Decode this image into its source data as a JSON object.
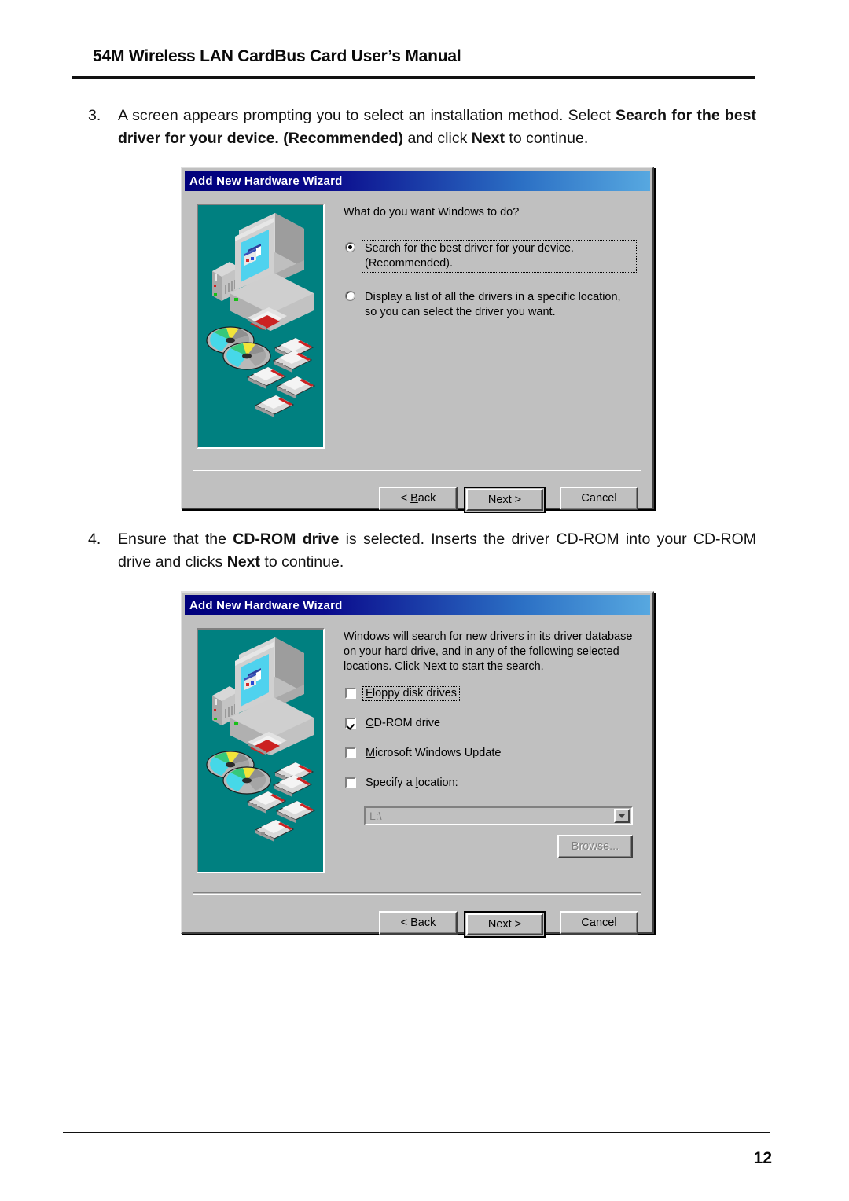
{
  "header": {
    "title": "54M Wireless LAN CardBus Card User’s Manual",
    "page_number": "12"
  },
  "steps": [
    {
      "number": "3.",
      "segments": [
        {
          "text": "A screen appears prompting you to select an installation method. Select ",
          "bold": false
        },
        {
          "text": "Search for the best driver for your device. (Recommended)",
          "bold": true
        },
        {
          "text": " and click ",
          "bold": false
        },
        {
          "text": "Next",
          "bold": true
        },
        {
          "text": " to continue.",
          "bold": false
        }
      ]
    },
    {
      "number": "4.",
      "segments": [
        {
          "text": "Ensure that the ",
          "bold": false
        },
        {
          "text": "CD-ROM drive",
          "bold": true
        },
        {
          "text": " is selected. Inserts the driver CD-ROM into your CD-ROM drive and clicks ",
          "bold": false
        },
        {
          "text": "Next",
          "bold": true
        },
        {
          "text": " to continue.",
          "bold": false
        }
      ]
    }
  ],
  "dialog1": {
    "title": "Add New Hardware Wizard",
    "prompt": "What do you want Windows to do?",
    "options": [
      {
        "label": "Search for the best driver for your device. (Recommended).",
        "selected": true,
        "focused": true
      },
      {
        "label": "Display a list of all the drivers in a specific location, so you can select the driver you want.",
        "selected": false,
        "focused": false
      }
    ],
    "buttons": {
      "back": "< Back",
      "next": "Next >",
      "cancel": "Cancel"
    }
  },
  "dialog2": {
    "title": "Add New Hardware Wizard",
    "prompt": "Windows will search for new drivers in its driver database on your hard drive, and in any of the following selected locations. Click Next to start the search.",
    "checkboxes": [
      {
        "accel": "F",
        "rest": "loppy disk drives",
        "checked": false,
        "focused": true
      },
      {
        "accel": "C",
        "rest": "D-ROM drive",
        "checked": true,
        "focused": false
      },
      {
        "accel": "M",
        "rest": "icrosoft Windows Update",
        "checked": false,
        "focused": false
      },
      {
        "accel": "",
        "rest": "Specify a location:",
        "checked": false,
        "focused": false
      }
    ],
    "location": {
      "value": "L:\\",
      "enabled": false
    },
    "browse_label": "Browse...",
    "browse_enabled": false,
    "buttons": {
      "back": "< Back",
      "next": "Next >",
      "cancel": "Cancel"
    }
  },
  "colors": {
    "titlebar_start": "#00007b",
    "titlebar_end": "#57a8e0",
    "dialog_face": "#c0c0c0",
    "illustration_bg": "#008080",
    "screen_cyan": "#4fd2ee"
  },
  "illustration": {
    "name": "computer-media-illustration",
    "elements": [
      "monitor",
      "tower",
      "floppy-drive",
      "cd-discs",
      "floppy-disks"
    ]
  }
}
